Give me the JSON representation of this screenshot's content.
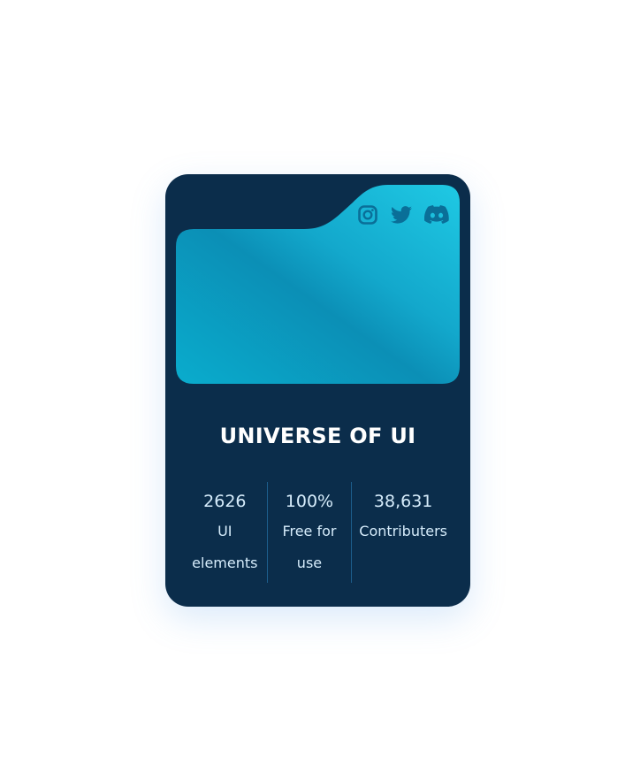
{
  "card": {
    "title": "UNIVERSE OF UI",
    "socials": [
      {
        "name": "instagram",
        "icon": "instagram-icon"
      },
      {
        "name": "twitter",
        "icon": "twitter-icon"
      },
      {
        "name": "discord",
        "icon": "discord-icon"
      }
    ],
    "stats": [
      {
        "value": "2626",
        "label": "UI elements"
      },
      {
        "value": "100%",
        "label": "Free for use"
      },
      {
        "value": "38,631",
        "label": "Contributers"
      }
    ]
  },
  "colors": {
    "page_background": "#ffffff",
    "card_background": "#0b2d4b",
    "banner_gradient_light": "#1cc4e0",
    "banner_gradient_dark": "#0a8fb7",
    "icon_color": "#0a6f98",
    "stat_text": "#d6ecfb",
    "divider": "#1d5e8c"
  }
}
